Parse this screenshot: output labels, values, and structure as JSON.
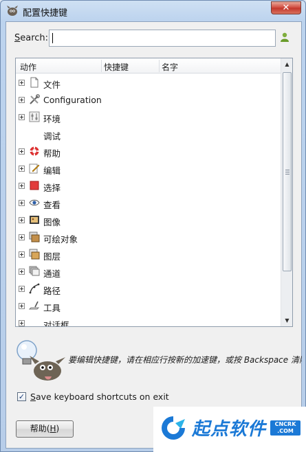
{
  "window": {
    "title": "配置快捷键",
    "close_label": "✕"
  },
  "search": {
    "label_prefix": "S",
    "label_rest": "earch:",
    "value": ""
  },
  "tree": {
    "columns": [
      "动作",
      "快捷键",
      "名字"
    ],
    "rows": [
      {
        "label": "文件",
        "expandable": true,
        "icon": "document-icon"
      },
      {
        "label": "Configuration",
        "expandable": true,
        "icon": "tools-icon"
      },
      {
        "label": "环境",
        "expandable": true,
        "icon": "sliders-icon"
      },
      {
        "label": "调试",
        "expandable": false,
        "icon": ""
      },
      {
        "label": "帮助",
        "expandable": true,
        "icon": "lifebuoy-icon"
      },
      {
        "label": "编辑",
        "expandable": true,
        "icon": "pencil-icon"
      },
      {
        "label": "选择",
        "expandable": true,
        "icon": "selection-icon"
      },
      {
        "label": "查看",
        "expandable": true,
        "icon": "eye-icon"
      },
      {
        "label": "图像",
        "expandable": true,
        "icon": "image-icon"
      },
      {
        "label": "可绘对象",
        "expandable": true,
        "icon": "drawable-icon"
      },
      {
        "label": "图层",
        "expandable": true,
        "icon": "layers-icon"
      },
      {
        "label": "通道",
        "expandable": true,
        "icon": "channels-icon"
      },
      {
        "label": "路径",
        "expandable": true,
        "icon": "path-icon"
      },
      {
        "label": "工具",
        "expandable": true,
        "icon": "tool-icon"
      },
      {
        "label": "对话框",
        "expandable": true,
        "icon": ""
      }
    ]
  },
  "hint": {
    "text": "要编辑快捷键，请在相应行按新的加速键，或按 Backspace 清除。"
  },
  "save_shortcuts": {
    "checked": true,
    "checkmark": "✓",
    "label_prefix": "S",
    "label_rest": "ave keyboard shortcuts on exit"
  },
  "help_button": {
    "label": "帮助(",
    "mnemonic": "H",
    "label_end": ")"
  },
  "watermark": {
    "text": "起点软件",
    "badge_line1": "CNCRK",
    "badge_line2": ".COM"
  },
  "colors": {
    "accent": "#1b79d6",
    "close": "#c2362b"
  }
}
